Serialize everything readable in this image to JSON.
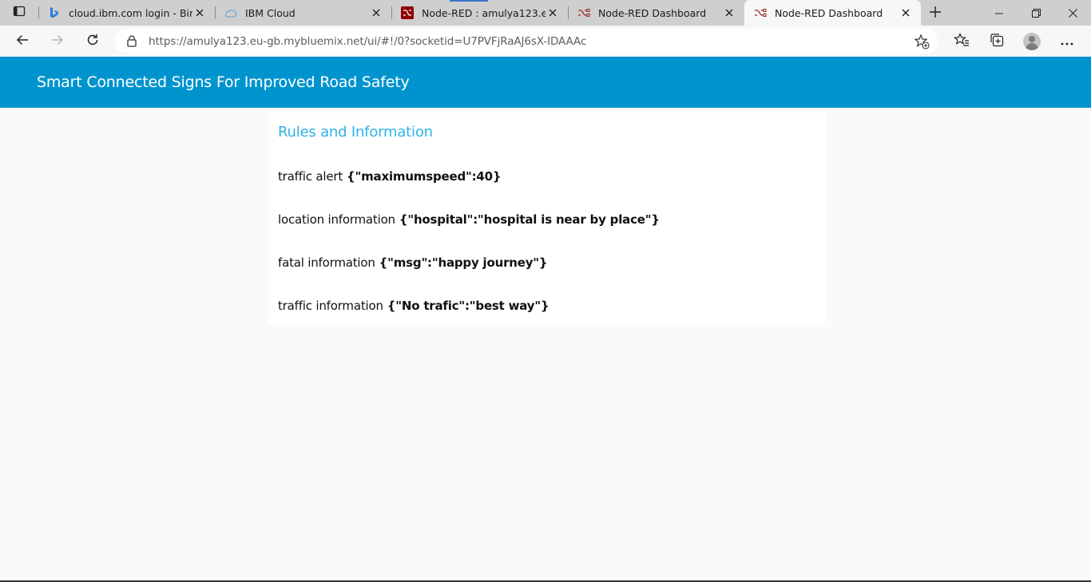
{
  "browser": {
    "tabs": [
      {
        "title": "cloud.ibm.com login - Bing",
        "icon": "bing-icon"
      },
      {
        "title": "IBM Cloud",
        "icon": "cloud-icon"
      },
      {
        "title": "Node-RED : amulya123.eu-gb",
        "icon": "node-red-icon"
      },
      {
        "title": "Node-RED Dashboard",
        "icon": "node-red-icon"
      },
      {
        "title": "Node-RED Dashboard",
        "icon": "node-red-icon",
        "active": true
      }
    ],
    "url": "https://amulya123.eu-gb.mybluemix.net/ui/#!/0?socketid=U7PVFjRaAJ6sX-IDAAAc"
  },
  "dashboard": {
    "title": "Smart Connected Signs For Improved Road Safety",
    "accent_color": "#0094ce",
    "card": {
      "title": "Rules and Information",
      "title_color": "#2fb2e8",
      "rows": [
        {
          "label": "traffic alert",
          "value": "{\"maximumspeed\":40}"
        },
        {
          "label": "location information",
          "value": "{\"hospital\":\"hospital is near by place\"}"
        },
        {
          "label": "fatal information",
          "value": "{\"msg\":\"happy journey\"}"
        },
        {
          "label": "traffic information",
          "value": "{\"No trafic\":\"best way\"}"
        }
      ]
    }
  }
}
